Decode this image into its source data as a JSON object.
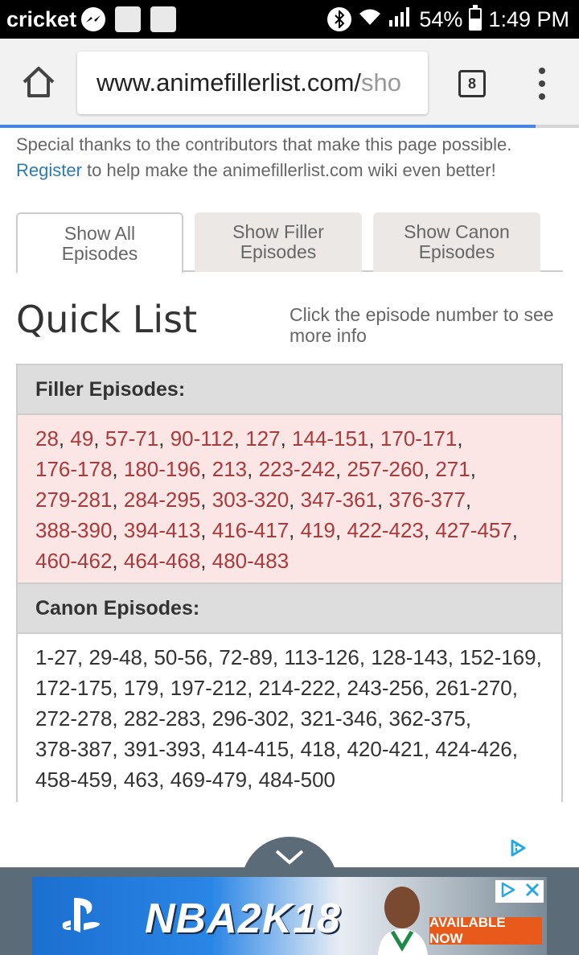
{
  "status_bar": {
    "carrier": "cricket",
    "battery": "54%",
    "battery_level": 0.54,
    "time": "1:49 PM"
  },
  "browser": {
    "url_main": "www.animefillerlist.com/",
    "url_rest": "sho",
    "tab_count": "8",
    "progress": 0.925
  },
  "page": {
    "thanks_line": "Special thanks to the contributors that make this page possible.",
    "register_link": "Register",
    "register_rest": " to help make the animefillerlist.com wiki even better!",
    "tabs": [
      {
        "line1": "Show All",
        "line2": "Episodes",
        "active": true
      },
      {
        "line1": "Show Filler",
        "line2": "Episodes",
        "active": false
      },
      {
        "line1": "Show Canon",
        "line2": "Episodes",
        "active": false
      }
    ],
    "quick_list_title": "Quick List",
    "quick_list_hint": "Click the episode number to see more info",
    "filler_heading": "Filler Episodes:",
    "filler_episodes": [
      "28",
      "49",
      "57-71",
      "90-112",
      "127",
      "144-151",
      "170-171",
      "176-178",
      "180-196",
      "213",
      "223-242",
      "257-260",
      "271",
      "279-281",
      "284-295",
      "303-320",
      "347-361",
      "376-377",
      "388-390",
      "394-413",
      "416-417",
      "419",
      "422-423",
      "427-457",
      "460-462",
      "464-468",
      "480-483"
    ],
    "canon_heading": "Canon Episodes:",
    "canon_episodes": [
      "1-27",
      "29-48",
      "50-56",
      "72-89",
      "113-126",
      "128-143",
      "152-169",
      "172-175",
      "179",
      "197-212",
      "214-222",
      "243-256",
      "261-270",
      "272-278",
      "282-283",
      "296-302",
      "321-346",
      "362-375",
      "378-387",
      "391-393",
      "414-415",
      "418",
      "420-421",
      "424-426",
      "458-459",
      "463",
      "469-479",
      "484-500"
    ]
  },
  "ad": {
    "title": "NBA2K18",
    "cta": "AVAILABLE NOW"
  }
}
